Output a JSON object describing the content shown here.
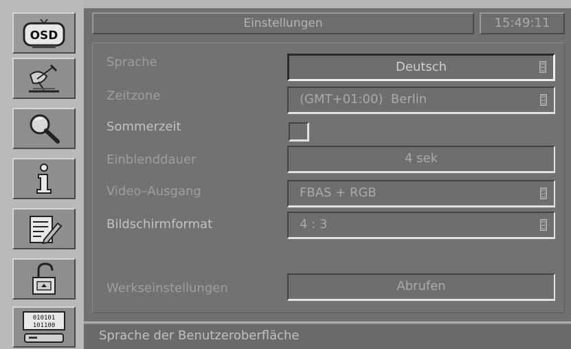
{
  "sidebar": {
    "items": [
      {
        "icon": "osd-icon",
        "text": "OSD"
      },
      {
        "icon": "satellite-dish-icon"
      },
      {
        "icon": "magnifier-icon"
      },
      {
        "icon": "info-icon",
        "text": "i"
      },
      {
        "icon": "edit-list-icon"
      },
      {
        "icon": "parental-lock-icon"
      },
      {
        "icon": "binary-receiver-icon",
        "text": "01 0101 / 10 1100"
      }
    ]
  },
  "header": {
    "title": "Einstellungen",
    "clock": "15:49:11"
  },
  "settings": {
    "sprache": {
      "label": "Sprache",
      "value": "Deutsch"
    },
    "zeitzone": {
      "label": "Zeitzone",
      "value": "(GMT+01:00)  Berlin"
    },
    "sommerzeit": {
      "label": "Sommerzeit",
      "checked": false
    },
    "einblenddauer": {
      "label": "Einblenddauer",
      "value": "4 sek"
    },
    "video_ausgang": {
      "label": "Video–Ausgang",
      "value": "FBAS + RGB"
    },
    "bildschirmformat": {
      "label": "Bildschirmformat",
      "value": "4 : 3"
    },
    "werkseinstellungen": {
      "label": "Werkseinstellungen",
      "value": "Abrufen"
    }
  },
  "status": {
    "text": "Sprache der Benutzeroberfläche"
  },
  "colors": {
    "panel": "#707070",
    "sidebar": "#b9b9b9",
    "text": "#a8a8a8"
  }
}
